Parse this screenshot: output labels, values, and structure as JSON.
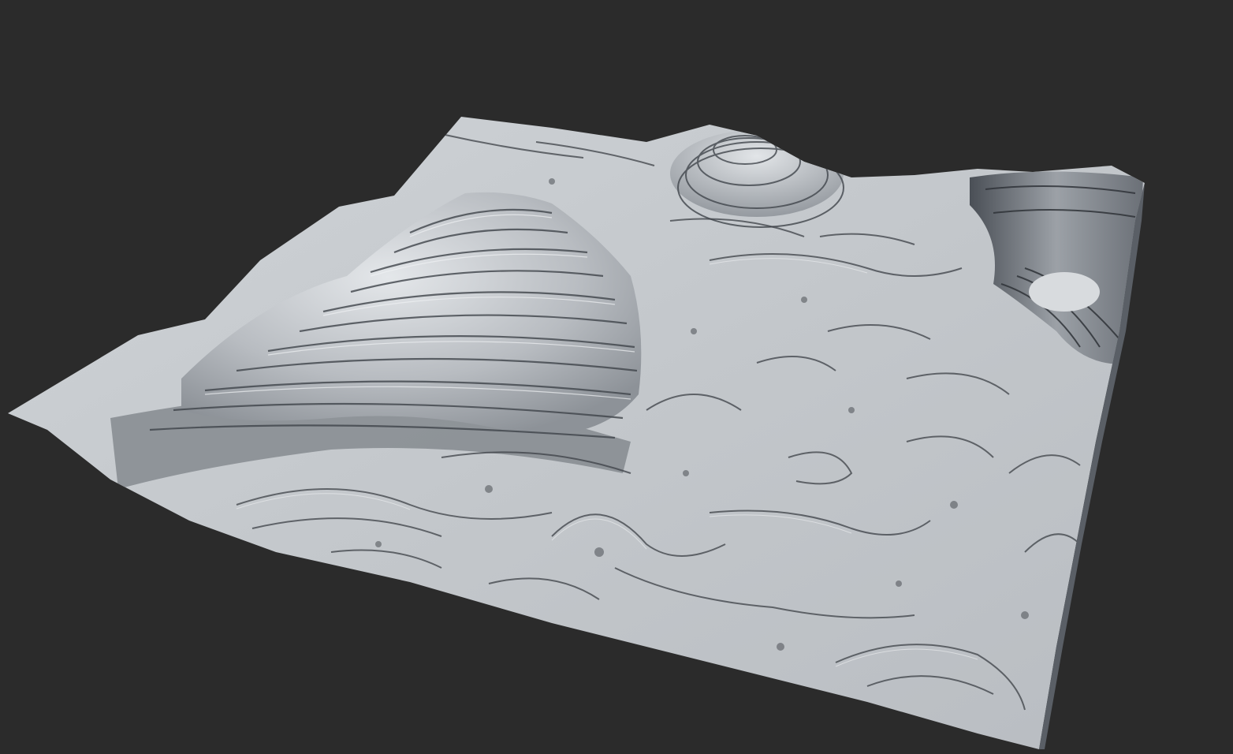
{
  "scene": {
    "background_color": "#2b2b2b",
    "terrain_base_color": "#c4c8cc",
    "terrain_highlight_color": "#e6e9ec",
    "terrain_shadow_color": "#3a3e44",
    "terrain_edge_shadow_color": "#6e737a"
  },
  "objects": [
    {
      "name": "terrain-heightfield-mesh",
      "type": "eroded terrain with terraced strata"
    },
    {
      "name": "main-mountain",
      "type": "terraced peak"
    },
    {
      "name": "back-center-hill",
      "type": "terraced hill"
    },
    {
      "name": "right-ridge",
      "type": "terraced cliff ridge"
    }
  ]
}
